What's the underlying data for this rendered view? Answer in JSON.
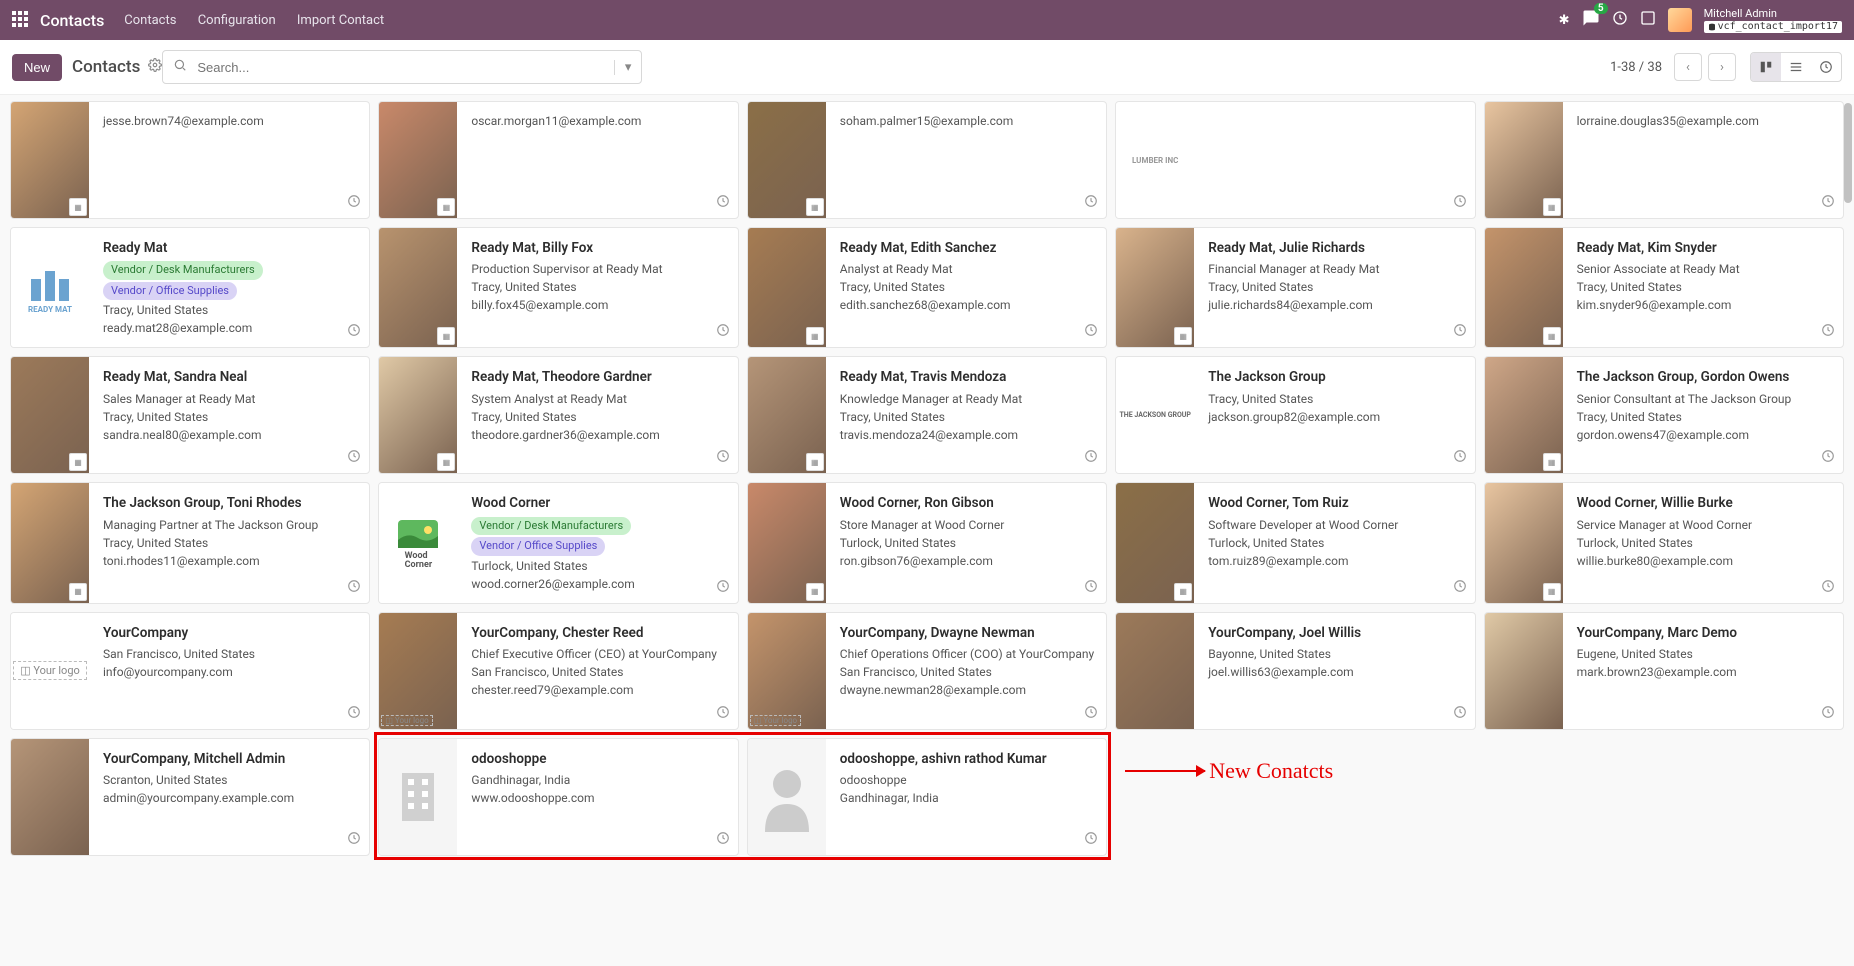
{
  "topbar": {
    "brand": "Contacts",
    "nav": [
      "Contacts",
      "Configuration",
      "Import Contact"
    ],
    "msg_count": "5",
    "user_name": "Mitchell Admin",
    "db_name": "vcf_contact_import17"
  },
  "actionbar": {
    "new_label": "New",
    "breadcrumb": "Contacts",
    "search_placeholder": "Search...",
    "pager": "1-38 / 38"
  },
  "cards": [
    {
      "name": "",
      "lines": [
        "jesse.brown74@example.com"
      ],
      "avatar": "photo",
      "mini": true
    },
    {
      "name": "",
      "lines": [
        "oscar.morgan11@example.com"
      ],
      "avatar": "photo",
      "mini": true
    },
    {
      "name": "",
      "lines": [
        "soham.palmer15@example.com"
      ],
      "avatar": "photo",
      "mini": true
    },
    {
      "name": "",
      "lines": [
        ""
      ],
      "avatar": "logo",
      "mini": false
    },
    {
      "name": "",
      "lines": [
        "lorraine.douglas35@example.com"
      ],
      "avatar": "photo",
      "mini": true
    },
    {
      "name": "Ready Mat",
      "tags": [
        {
          "text": "Vendor / Desk Manufacturers",
          "cls": "green"
        },
        {
          "text": "Vendor / Office Supplies",
          "cls": "purple"
        }
      ],
      "lines": [
        "Tracy, United States",
        "ready.mat28@example.com"
      ],
      "avatar": "readymat"
    },
    {
      "name": "Ready Mat, Billy Fox",
      "lines": [
        "Production Supervisor at Ready Mat",
        "Tracy, United States",
        "billy.fox45@example.com"
      ],
      "avatar": "photo",
      "mini": true
    },
    {
      "name": "Ready Mat, Edith Sanchez",
      "lines": [
        "Analyst at Ready Mat",
        "Tracy, United States",
        "edith.sanchez68@example.com"
      ],
      "avatar": "photo",
      "mini": true
    },
    {
      "name": "Ready Mat, Julie Richards",
      "lines": [
        "Financial Manager at Ready Mat",
        "Tracy, United States",
        "julie.richards84@example.com"
      ],
      "avatar": "photo",
      "mini": true
    },
    {
      "name": "Ready Mat, Kim Snyder",
      "lines": [
        "Senior Associate at Ready Mat",
        "Tracy, United States",
        "kim.snyder96@example.com"
      ],
      "avatar": "photo",
      "mini": true
    },
    {
      "name": "Ready Mat, Sandra Neal",
      "lines": [
        "Sales Manager at Ready Mat",
        "Tracy, United States",
        "sandra.neal80@example.com"
      ],
      "avatar": "photo",
      "mini": true
    },
    {
      "name": "Ready Mat, Theodore Gardner",
      "lines": [
        "System Analyst at Ready Mat",
        "Tracy, United States",
        "theodore.gardner36@example.com"
      ],
      "avatar": "photo",
      "mini": true
    },
    {
      "name": "Ready Mat, Travis Mendoza",
      "lines": [
        "Knowledge Manager at Ready Mat",
        "Tracy, United States",
        "travis.mendoza24@example.com"
      ],
      "avatar": "photo",
      "mini": true
    },
    {
      "name": "The Jackson Group",
      "lines": [
        "Tracy, United States",
        "jackson.group82@example.com"
      ],
      "avatar": "jackson"
    },
    {
      "name": "The Jackson Group, Gordon Owens",
      "lines": [
        "Senior Consultant at The Jackson Group",
        "Tracy, United States",
        "gordon.owens47@example.com"
      ],
      "avatar": "photo",
      "mini": true
    },
    {
      "name": "The Jackson Group, Toni Rhodes",
      "lines": [
        "Managing Partner at The Jackson Group",
        "Tracy, United States",
        "toni.rhodes11@example.com"
      ],
      "avatar": "photo",
      "mini": true
    },
    {
      "name": "Wood Corner",
      "tags": [
        {
          "text": "Vendor / Desk Manufacturers",
          "cls": "green"
        },
        {
          "text": "Vendor / Office Supplies",
          "cls": "purple"
        }
      ],
      "lines": [
        "Turlock, United States",
        "wood.corner26@example.com"
      ],
      "avatar": "woodcorner"
    },
    {
      "name": "Wood Corner, Ron Gibson",
      "lines": [
        "Store Manager at Wood Corner",
        "Turlock, United States",
        "ron.gibson76@example.com"
      ],
      "avatar": "photo",
      "mini": true
    },
    {
      "name": "Wood Corner, Tom Ruiz",
      "lines": [
        "Software Developer at Wood Corner",
        "Turlock, United States",
        "tom.ruiz89@example.com"
      ],
      "avatar": "photo",
      "mini": true
    },
    {
      "name": "Wood Corner, Willie Burke",
      "lines": [
        "Service Manager at Wood Corner",
        "Turlock, United States",
        "willie.burke80@example.com"
      ],
      "avatar": "photo",
      "mini": true
    },
    {
      "name": "YourCompany",
      "lines": [
        "San Francisco, United States",
        "info@yourcompany.com"
      ],
      "avatar": "yourlogo"
    },
    {
      "name": "YourCompany, Chester Reed",
      "lines": [
        "Chief Executive Officer (CEO) at YourCompany",
        "San Francisco, United States",
        "chester.reed79@example.com"
      ],
      "avatar": "photo",
      "mini": "yourlogo"
    },
    {
      "name": "YourCompany, Dwayne Newman",
      "lines": [
        "Chief Operations Officer (COO) at YourCompany",
        "San Francisco, United States",
        "dwayne.newman28@example.com"
      ],
      "avatar": "photo",
      "mini": "yourlogo"
    },
    {
      "name": "YourCompany, Joel Willis",
      "lines": [
        "Bayonne, United States",
        "joel.willis63@example.com"
      ],
      "avatar": "photo-cartoon"
    },
    {
      "name": "YourCompany, Marc Demo",
      "lines": [
        "Eugene, United States",
        "mark.brown23@example.com"
      ],
      "avatar": "photo-cartoon"
    },
    {
      "name": "YourCompany, Mitchell Admin",
      "lines": [
        "Scranton, United States",
        "admin@yourcompany.example.com"
      ],
      "avatar": "photo-cartoon"
    },
    {
      "name": "odooshoppe",
      "lines": [
        "Gandhinagar, India",
        "www.odooshoppe.com"
      ],
      "avatar": "company-ph",
      "highlight": true
    },
    {
      "name": "odooshoppe, ashivn rathod Kumar",
      "lines": [
        "odooshoppe",
        "Gandhinagar, India"
      ],
      "avatar": "person-ph",
      "highlight": true
    }
  ],
  "annotation": "New Conatcts"
}
